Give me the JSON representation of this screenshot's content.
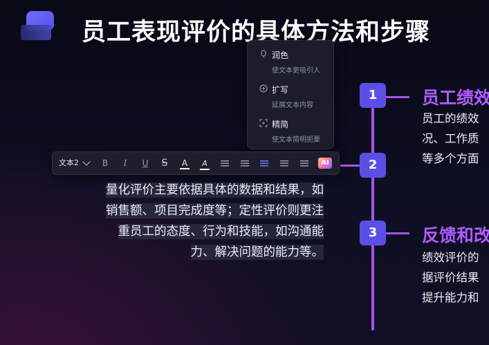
{
  "slide": {
    "title": "员工表现评价的具体方法和步骤"
  },
  "ai_menu": {
    "items": [
      {
        "icon": "polish-icon",
        "label": "润色",
        "desc": "使文本更吸引人"
      },
      {
        "icon": "expand-icon",
        "label": "扩写",
        "desc": "延展文本内容"
      },
      {
        "icon": "condense-icon",
        "label": "精简",
        "desc": "使文本简明扼要"
      }
    ]
  },
  "toolbar": {
    "text_style": "文本2",
    "bold": "B",
    "italic": "I",
    "underline": "U",
    "strikethrough": "S",
    "font_color_label": "A",
    "highlight_label": "A",
    "ai_label": "AI",
    "font_color": "#ffffff",
    "highlight_color": "#ffffff",
    "accent_color": "#7a7cff"
  },
  "paragraph": {
    "lines": [
      "量化评价主要依据具体的数据和结果，如",
      "销售额、项目完成度等；定性评价则更注",
      "重员工的态度、行为和技能，如沟通能",
      "力、解决问题的能力等。"
    ]
  },
  "timeline": {
    "line_color": "#a755e8",
    "badge_color": "#5a50e6",
    "steps": [
      {
        "number": "1",
        "title": "员工绩效",
        "body": [
          "员工的绩效",
          "况、工作质",
          "等多个方面"
        ]
      },
      {
        "number": "2"
      },
      {
        "number": "3",
        "title": "反馈和改",
        "body": [
          "绩效评价的",
          "据评价结果",
          "提升能力和"
        ]
      }
    ]
  }
}
